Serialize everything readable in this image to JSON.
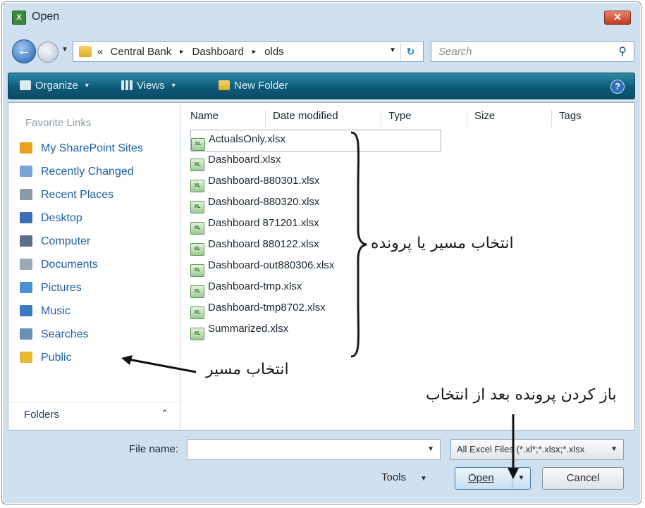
{
  "window": {
    "title": "Open",
    "app_icon": "excel-icon",
    "close_label": "✕"
  },
  "address_bar": {
    "prefix": "«",
    "breadcrumbs": [
      "Central Bank",
      "Dashboard",
      "olds"
    ],
    "separator": "►",
    "search_placeholder": "Search"
  },
  "toolbar": {
    "organize_label": "Organize",
    "views_label": "Views",
    "new_folder_label": "New Folder"
  },
  "nav_pane": {
    "favorites_header": "Favorite Links",
    "items": [
      {
        "label": "My SharePoint Sites",
        "icon": "sharepoint-icon",
        "color": "#e8a21c"
      },
      {
        "label": "Recently Changed",
        "icon": "recently-changed-icon",
        "color": "#7aa6d6"
      },
      {
        "label": "Recent Places",
        "icon": "recent-places-icon",
        "color": "#8a9aab"
      },
      {
        "label": "Desktop",
        "icon": "desktop-icon",
        "color": "#3d6fb2"
      },
      {
        "label": "Computer",
        "icon": "computer-icon",
        "color": "#5c6f86"
      },
      {
        "label": "Documents",
        "icon": "documents-icon",
        "color": "#9aa8b6"
      },
      {
        "label": "Pictures",
        "icon": "pictures-icon",
        "color": "#4a8fd0"
      },
      {
        "label": "Music",
        "icon": "music-icon",
        "color": "#3a7ac4"
      },
      {
        "label": "Searches",
        "icon": "searches-icon",
        "color": "#6a90b8"
      },
      {
        "label": "Public",
        "icon": "public-folder-icon",
        "color": "#e8b830"
      }
    ],
    "folders_label": "Folders",
    "folders_caret": "⌃"
  },
  "file_list": {
    "columns": [
      "Name",
      "Date modified",
      "Type",
      "Size",
      "Tags"
    ],
    "files": [
      "ActualsOnly.xlsx",
      "Dashboard.xlsx",
      "Dashboard-880301.xlsx",
      "Dashboard-880320.xlsx",
      "Dashboard 871201.xlsx",
      "Dashboard 880122.xlsx",
      "Dashboard-out880306.xlsx",
      "Dashboard-tmp.xlsx",
      "Dashboard-tmp8702.xlsx",
      "Summarized.xlsx"
    ]
  },
  "annotations": {
    "select_path_or_file": "انتخاب مسیر یا پرونده",
    "select_path": "انتخاب مسیر",
    "open_after_select": "باز کردن پرونده بعد از انتخاب"
  },
  "bottom": {
    "file_name_label": "File name:",
    "file_name_value": "",
    "file_type": "All Excel Files (*.xl*;*.xlsx;*.xlsx",
    "tools_label": "Tools",
    "open_label": "Open",
    "cancel_label": "Cancel"
  }
}
